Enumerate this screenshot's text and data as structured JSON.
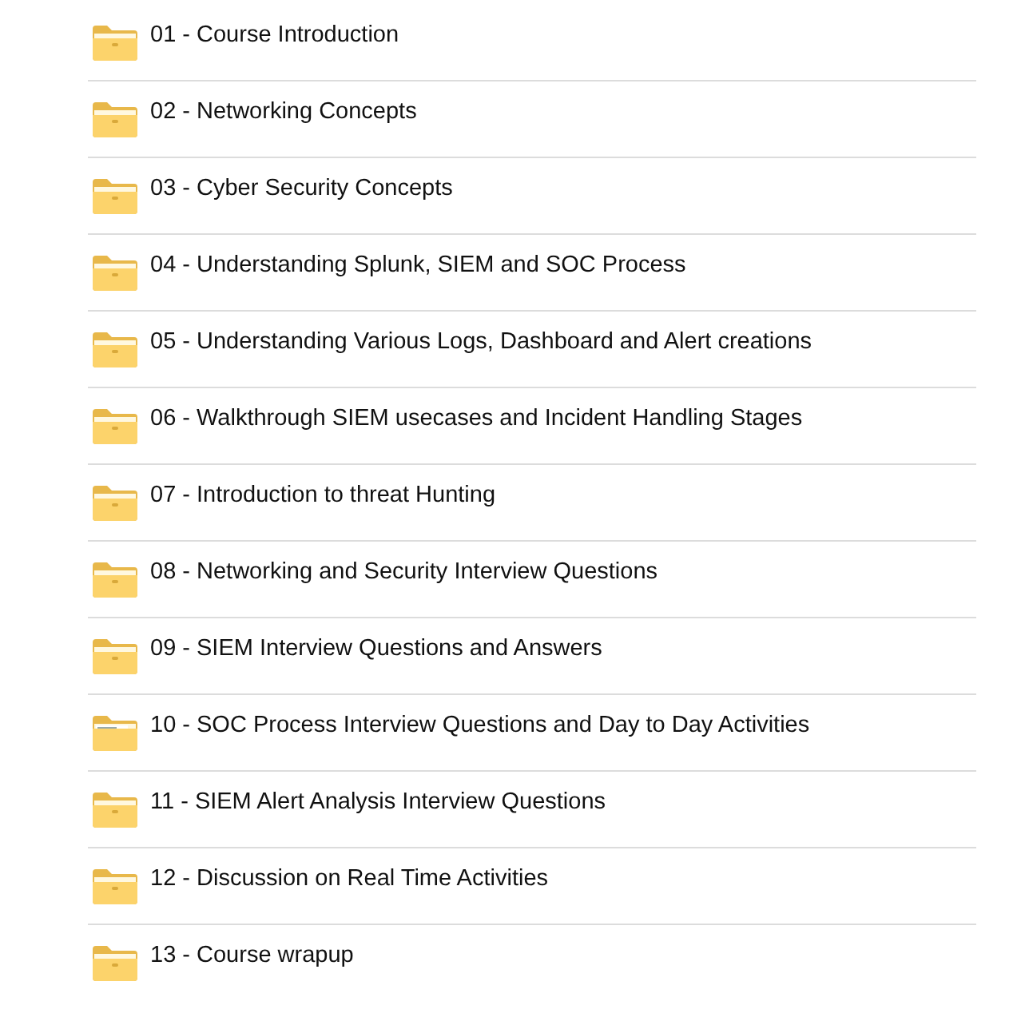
{
  "folders": [
    {
      "name": "01 - Course Introduction",
      "kind": "empty"
    },
    {
      "name": "02 - Networking Concepts",
      "kind": "empty"
    },
    {
      "name": "03 - Cyber Security Concepts",
      "kind": "empty"
    },
    {
      "name": "04 - Understanding Splunk, SIEM and SOC Process",
      "kind": "empty"
    },
    {
      "name": "05 - Understanding Various Logs, Dashboard and Alert creations",
      "kind": "empty"
    },
    {
      "name": "06 - Walkthrough SIEM usecases and Incident Handling Stages",
      "kind": "empty"
    },
    {
      "name": "07 - Introduction to threat Hunting",
      "kind": "empty"
    },
    {
      "name": "08 - Networking and Security Interview Questions",
      "kind": "empty"
    },
    {
      "name": "09 - SIEM Interview Questions and Answers",
      "kind": "empty"
    },
    {
      "name": "10 - SOC Process Interview Questions and Day to Day Activities",
      "kind": "documents"
    },
    {
      "name": "11 - SIEM Alert Analysis Interview Questions",
      "kind": "empty"
    },
    {
      "name": "12 - Discussion on Real Time Activities",
      "kind": "empty"
    },
    {
      "name": "13 - Course wrapup",
      "kind": "empty"
    }
  ]
}
